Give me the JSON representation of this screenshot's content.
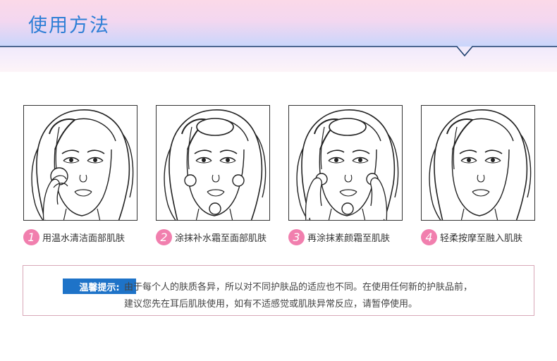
{
  "header": {
    "title": "使用方法"
  },
  "steps": [
    {
      "number": "1",
      "text": "用温水清洁面部肌肤"
    },
    {
      "number": "2",
      "text": "涂抹补水霜至面部肌肤"
    },
    {
      "number": "3",
      "text": "再涂抹素颜霜至肌肤"
    },
    {
      "number": "4",
      "text": "轻柔按摩至融入肌肤"
    }
  ],
  "tips": {
    "label": "温馨提示:",
    "line1": "由于每个人的肤质各异，所以对不同护肤品的适应也不同。在使用任何新的护肤品前，",
    "line2": "建议您先在耳后肌肤使用，如有不适感觉或肌肤异常反应，请暂停使用。"
  },
  "colors": {
    "accent": "#2e7fd6",
    "badge": "#f17fae",
    "tip_label_bg": "#1e73c8",
    "border": "#d9a8b8"
  }
}
